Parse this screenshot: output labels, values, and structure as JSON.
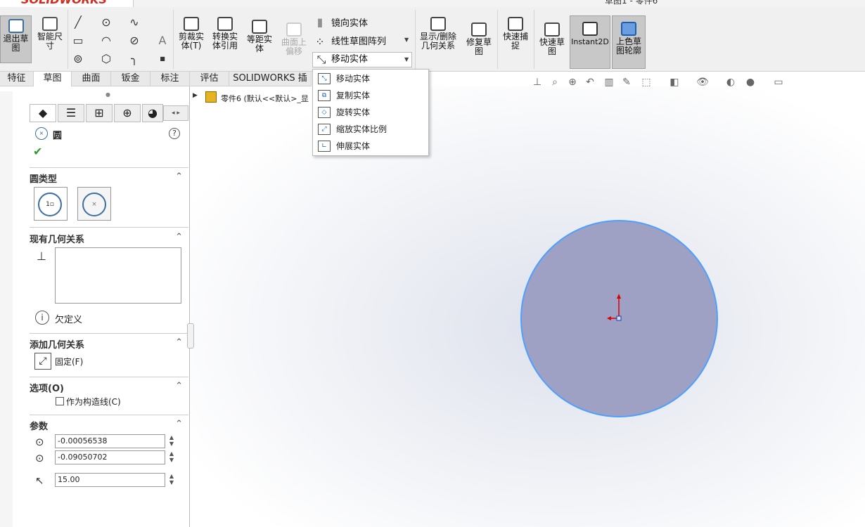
{
  "app": {
    "logo": "SOLIDWORKS",
    "title": "草图1 - 零件6"
  },
  "ribbon": {
    "exit_sketch": "退出草\n图",
    "smart_dim": "智能尺\n寸",
    "trim": "剪裁实\n体(T)",
    "convert": "转换实\n体引用",
    "offset": "等距实\n体",
    "surface_offset": "曲面上\n偏移",
    "mirror": "镜向实体",
    "linear_pattern": "线性草图阵列",
    "move": "移动实体",
    "show_relations": "显示/删除\n几何关系",
    "repair": "修复草\n图",
    "quick_snap": "快速捕\n捉",
    "rapid_sketch": "快速草\n图",
    "instant2d": "Instant2D",
    "shaded_sketch": "上色草\n图轮廓"
  },
  "tabs": [
    "特征",
    "草图",
    "曲面",
    "钣金",
    "标注",
    "评估",
    "SOLIDWORKS 插件"
  ],
  "tree": {
    "part": "零件6  (默认<<默认>_显"
  },
  "menu": {
    "items": [
      "移动实体",
      "复制实体",
      "旋转实体",
      "缩放实体比例",
      "伸展实体"
    ]
  },
  "panel": {
    "title": "圆",
    "sec_circle_type": "圆类型",
    "sec_existing": "现有几何关系",
    "status": "欠定义",
    "sec_add": "添加几何关系",
    "fix": "固定(F)",
    "sec_options": "选项(O)",
    "construction": "作为构造线(C)",
    "sec_params": "参数",
    "x": "-0.00056538",
    "y": "-0.09050702",
    "r": "15.00"
  }
}
